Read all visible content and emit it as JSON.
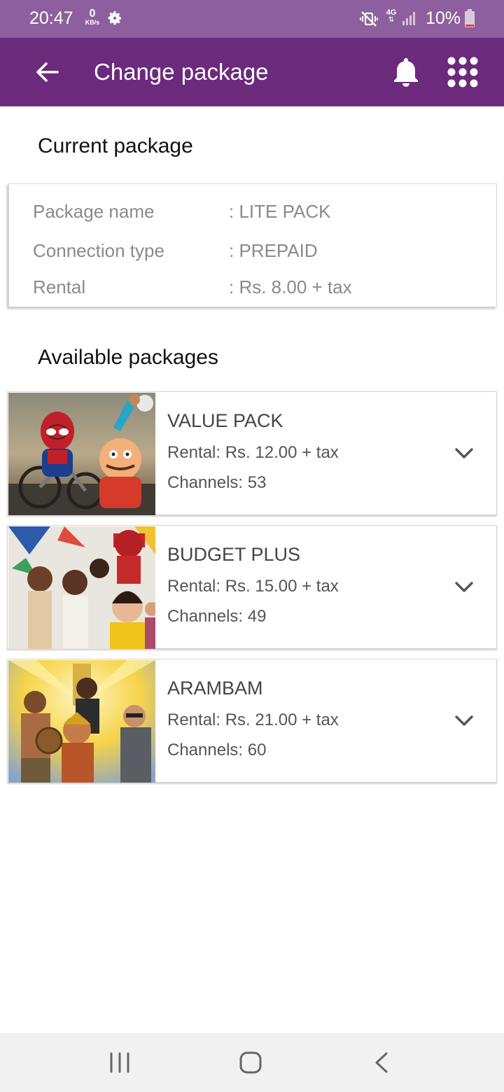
{
  "status_bar": {
    "time": "20:47",
    "data_rate_value": "0",
    "data_rate_unit": "KB/s",
    "network": "4G",
    "battery": "10%"
  },
  "app_bar": {
    "title": "Change package"
  },
  "current": {
    "heading": "Current package",
    "rows": [
      {
        "label": "Package name",
        "value": ": LITE PACK"
      },
      {
        "label": "Connection type",
        "value": ": PREPAID"
      },
      {
        "label": "Rental",
        "value": ": Rs. 8.00 + tax"
      }
    ]
  },
  "available": {
    "heading": "Available packages",
    "packages": [
      {
        "name": "VALUE PACK",
        "rental": "Rental: Rs. 12.00 + tax",
        "channels": "Channels: 53",
        "thumbnail": "cartoon-poster"
      },
      {
        "name": "BUDGET PLUS",
        "rental": "Rental: Rs. 15.00 + tax",
        "channels": "Channels: 49",
        "thumbnail": "entertainment-collage"
      },
      {
        "name": "ARAMBAM",
        "rental": "Rental: Rs. 21.00 + tax",
        "channels": "Channels: 60",
        "thumbnail": "movie-poster"
      }
    ]
  },
  "colors": {
    "status_bar": "#8e5f9e",
    "app_bar": "#6b2a7b",
    "nav_bar": "#f1f1f1"
  }
}
